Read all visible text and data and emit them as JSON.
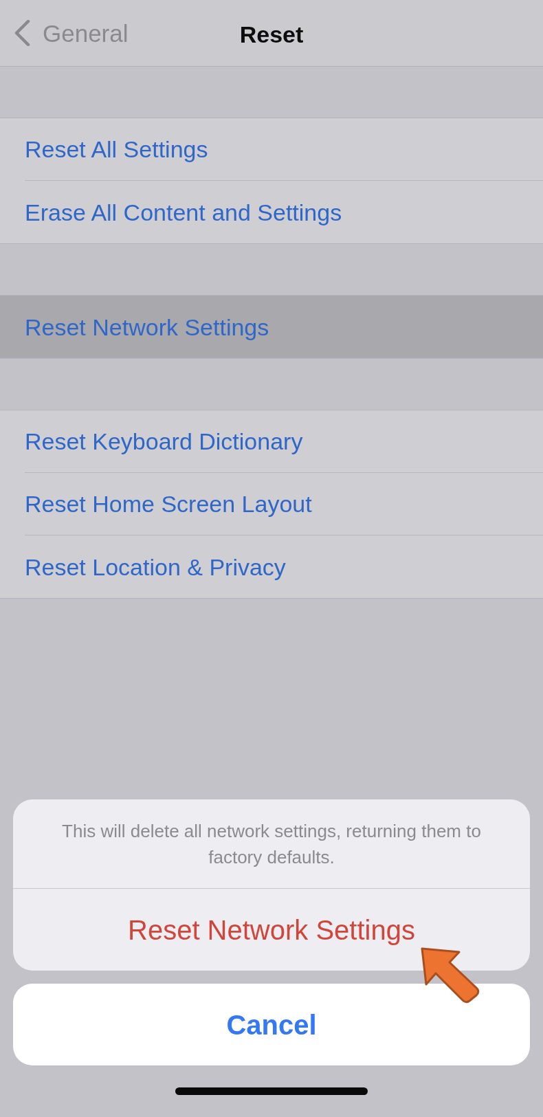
{
  "nav_bar": {
    "back_label": "General",
    "title": "Reset"
  },
  "sections": [
    {
      "items": [
        {
          "label": "Reset All Settings",
          "selected": false
        },
        {
          "label": "Erase All Content and Settings",
          "selected": false
        }
      ]
    },
    {
      "items": [
        {
          "label": "Reset Network Settings",
          "selected": true
        }
      ]
    },
    {
      "items": [
        {
          "label": "Reset Keyboard Dictionary",
          "selected": false
        },
        {
          "label": "Reset Home Screen Layout",
          "selected": false
        },
        {
          "label": "Reset Location & Privacy",
          "selected": false
        }
      ]
    }
  ],
  "action_sheet": {
    "message": "This will delete all network settings, returning them to factory defaults.",
    "actions": [
      {
        "label": "Reset Network Settings",
        "kind": "destructive"
      }
    ],
    "cancel": {
      "label": "Cancel"
    }
  }
}
